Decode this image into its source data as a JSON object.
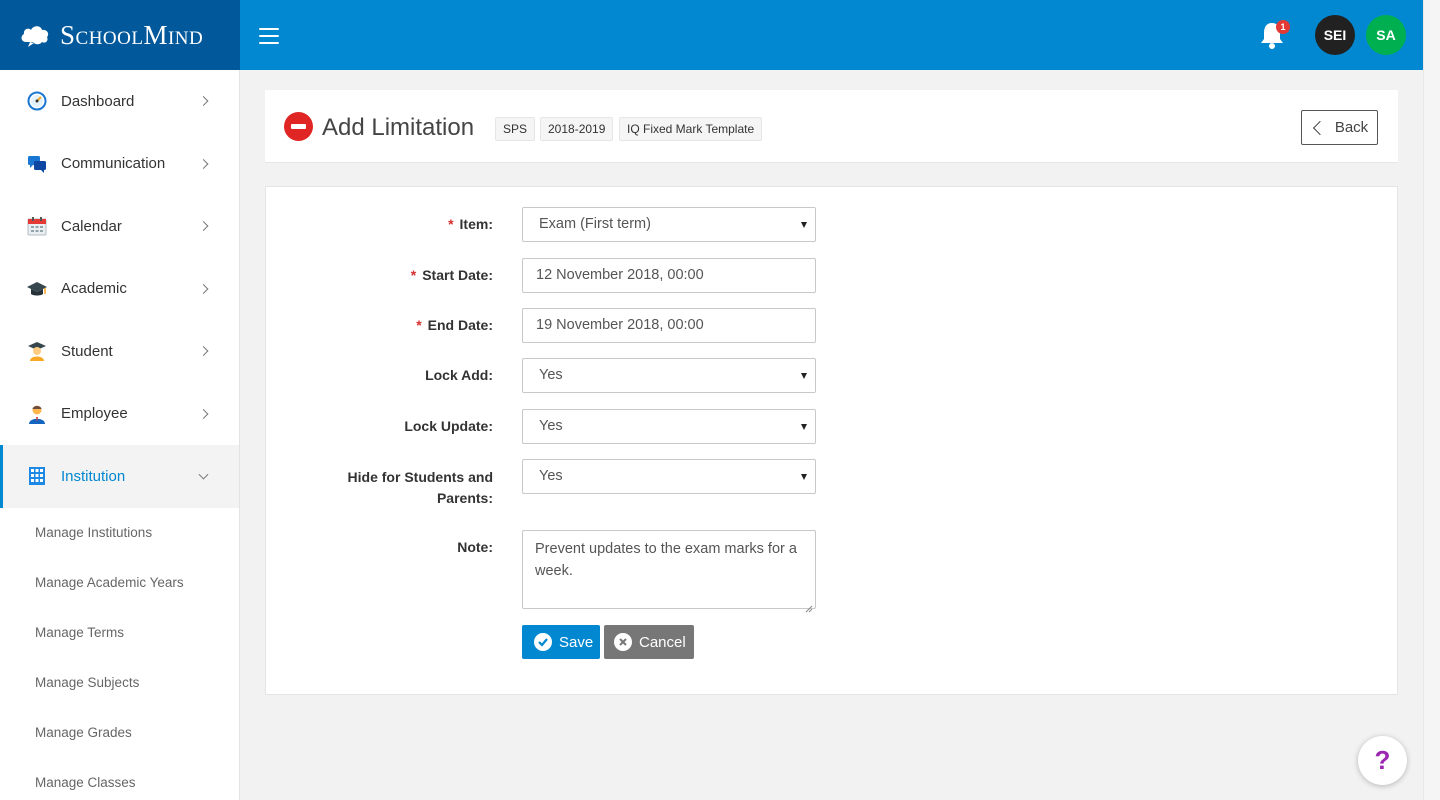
{
  "app": {
    "brand": "SchoolMind"
  },
  "topbar": {
    "notification_count": "1",
    "avatars": [
      "SEI",
      "SA"
    ]
  },
  "sidebar": {
    "items": [
      {
        "label": "Dashboard",
        "icon": "dashboard-gauge-icon"
      },
      {
        "label": "Communication",
        "icon": "chat-bubbles-icon"
      },
      {
        "label": "Calendar",
        "icon": "calendar-icon"
      },
      {
        "label": "Academic",
        "icon": "graduation-cap-icon"
      },
      {
        "label": "Student",
        "icon": "student-icon"
      },
      {
        "label": "Employee",
        "icon": "employee-icon"
      },
      {
        "label": "Institution",
        "icon": "building-icon",
        "active": true
      }
    ],
    "subitems": [
      "Manage Institutions",
      "Manage Academic Years",
      "Manage Terms",
      "Manage Subjects",
      "Manage Grades",
      "Manage Classes"
    ]
  },
  "header": {
    "title": "Add Limitation",
    "tags": [
      "SPS",
      "2018-2019",
      "IQ Fixed Mark Template"
    ],
    "back_label": "Back"
  },
  "form": {
    "item": {
      "label": "Item:",
      "value": "Exam (First term)",
      "required": true
    },
    "start_date": {
      "label": "Start Date:",
      "value": "12 November 2018, 00:00",
      "required": true
    },
    "end_date": {
      "label": "End Date:",
      "value": "19 November 2018, 00:00",
      "required": true
    },
    "lock_add": {
      "label": "Lock Add:",
      "value": "Yes"
    },
    "lock_update": {
      "label": "Lock Update:",
      "value": "Yes"
    },
    "hide_for": {
      "label_line1": "Hide for Students and",
      "label_line2": "Parents:",
      "value": "Yes"
    },
    "note": {
      "label": "Note:",
      "value_line1": "Prevent updates to the exam marks for a",
      "value_line2": "week."
    },
    "required_mark": "*",
    "save_label": "Save",
    "cancel_label": "Cancel"
  },
  "help": {
    "label": "?"
  },
  "colors": {
    "brand_dark": "#01589b",
    "topbar": "#0288d1",
    "accent": "#0288d1",
    "danger": "#e02525",
    "success_avatar": "#00b050"
  }
}
